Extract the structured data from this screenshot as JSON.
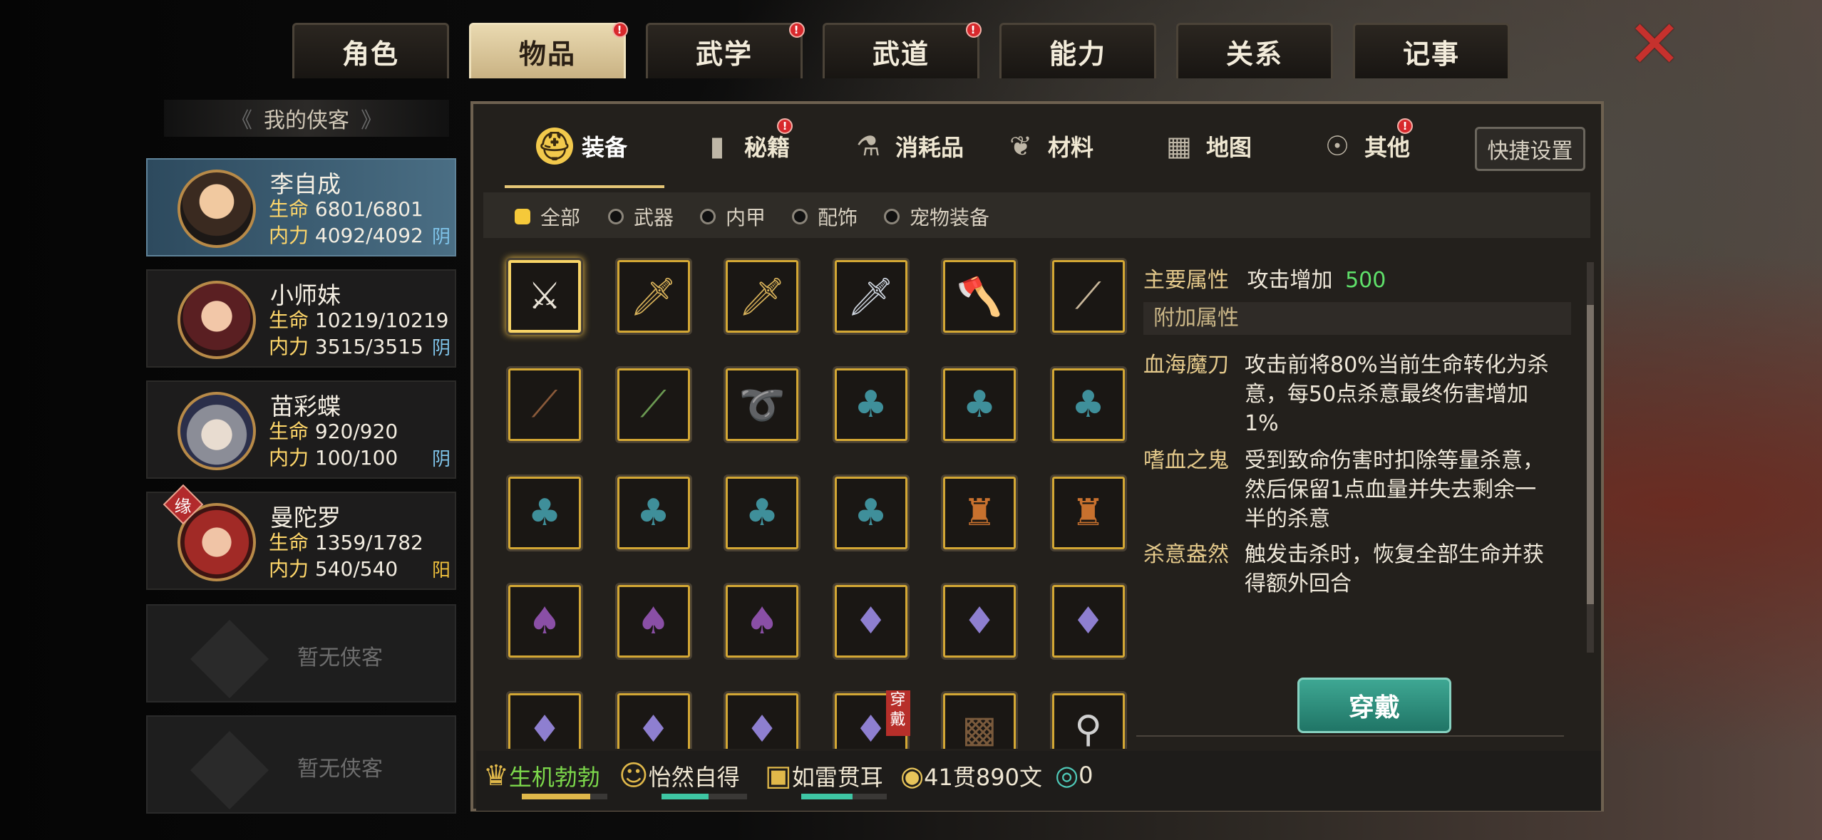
{
  "top_tabs": [
    {
      "label": "角色",
      "badge": false,
      "active": false
    },
    {
      "label": "物品",
      "badge": true,
      "active": true
    },
    {
      "label": "武学",
      "badge": true,
      "active": false
    },
    {
      "label": "武道",
      "badge": true,
      "active": false
    },
    {
      "label": "能力",
      "badge": false,
      "active": false
    },
    {
      "label": "关系",
      "badge": false,
      "active": false
    },
    {
      "label": "记事",
      "badge": false,
      "active": false
    }
  ],
  "badge_mark": "!",
  "left": {
    "header": "我的侠客",
    "heroes": [
      {
        "name": "李自成",
        "hp_label": "生命",
        "hp": "6801/6801",
        "mp_label": "内力",
        "mp": "4092/4092",
        "tag": "阴",
        "selected": true
      },
      {
        "name": "小师妹",
        "hp_label": "生命",
        "hp": "10219/10219",
        "mp_label": "内力",
        "mp": "3515/3515",
        "tag": "阴",
        "selected": false
      },
      {
        "name": "苗彩蝶",
        "hp_label": "生命",
        "hp": "920/920",
        "mp_label": "内力",
        "mp": "100/100",
        "tag": "阴",
        "selected": false
      },
      {
        "name": "曼陀罗",
        "hp_label": "生命",
        "hp": "1359/1782",
        "mp_label": "内力",
        "mp": "540/540",
        "tag": "阳",
        "selected": false,
        "fate": "缘"
      }
    ],
    "empty_slots": [
      "暂无侠客",
      "暂无侠客"
    ]
  },
  "sub_tabs": [
    {
      "label": "装备",
      "icon": "helmet-icon",
      "badge": false
    },
    {
      "label": "秘籍",
      "icon": "book-icon",
      "badge": true
    },
    {
      "label": "消耗品",
      "icon": "potion-icon",
      "badge": false
    },
    {
      "label": "材料",
      "icon": "herb-icon",
      "badge": false
    },
    {
      "label": "地图",
      "icon": "map-icon",
      "badge": false
    },
    {
      "label": "其他",
      "icon": "misc-icon",
      "badge": true
    }
  ],
  "quick_settings": "快捷设置",
  "filters": [
    {
      "label": "全部",
      "on": true
    },
    {
      "label": "武器",
      "on": false
    },
    {
      "label": "内甲",
      "on": false
    },
    {
      "label": "配饰",
      "on": false
    },
    {
      "label": "宠物装备",
      "on": false
    }
  ],
  "items": [
    {
      "icon": "saber-icon",
      "color": "#e8e2d6"
    },
    {
      "icon": "sword-icon",
      "color": "#d8b25a"
    },
    {
      "icon": "sword-icon",
      "color": "#d8b25a"
    },
    {
      "icon": "broadsword-icon",
      "color": "#cfd6e0"
    },
    {
      "icon": "axe-icon",
      "color": "#c77b3a"
    },
    {
      "icon": "spear-icon",
      "color": "#c9b79a"
    },
    {
      "icon": "staff-icon",
      "color": "#8a5a3a"
    },
    {
      "icon": "flute-icon",
      "color": "#6b9a52"
    },
    {
      "icon": "whip-icon",
      "color": "#5d8ea6"
    },
    {
      "icon": "cloak-icon",
      "color": "#3f8f9a"
    },
    {
      "icon": "cloak-icon",
      "color": "#3f8f9a"
    },
    {
      "icon": "cloak-icon",
      "color": "#3f8f9a"
    },
    {
      "icon": "cloak-icon",
      "color": "#3f8f9a"
    },
    {
      "icon": "cloak-icon",
      "color": "#3f8f9a"
    },
    {
      "icon": "cloak-icon",
      "color": "#3f8f9a"
    },
    {
      "icon": "cloak-icon",
      "color": "#3f8f9a"
    },
    {
      "icon": "armor-icon",
      "color": "#c8712e"
    },
    {
      "icon": "armor-icon",
      "color": "#c8712e"
    },
    {
      "icon": "robe-icon",
      "color": "#8a4fa6"
    },
    {
      "icon": "robe-icon",
      "color": "#8a4fa6"
    },
    {
      "icon": "robe-icon",
      "color": "#8a4fa6"
    },
    {
      "icon": "gown-icon",
      "color": "#8e7fd0"
    },
    {
      "icon": "gown-icon",
      "color": "#8e7fd0"
    },
    {
      "icon": "gown-icon",
      "color": "#8e7fd0"
    },
    {
      "icon": "gown-icon",
      "color": "#8e7fd0"
    },
    {
      "icon": "gown-icon",
      "color": "#8e7fd0"
    },
    {
      "icon": "gown-icon",
      "color": "#8e7fd0"
    },
    {
      "icon": "gown-icon",
      "color": "#8e7fd0",
      "worn": "穿戴"
    },
    {
      "icon": "vest-icon",
      "color": "#7a5a3c"
    },
    {
      "icon": "trinket-icon",
      "color": "#d0d0d0"
    }
  ],
  "detail": {
    "main_label": "主要属性",
    "main_text": "攻击增加",
    "main_value": "500",
    "extra_header": "附加属性",
    "effects": [
      {
        "name": "血海魔刀",
        "lines": [
          "攻击前将80%当前生命转化为杀",
          "意，每50点杀意最终伤害增加",
          "1%"
        ]
      },
      {
        "name": "嗜血之鬼",
        "lines": [
          "受到致命伤害时扣除等量杀意，",
          "然后保留1点血量并失去剩余一",
          "半的杀意"
        ]
      },
      {
        "name": "杀意盎然",
        "lines": [
          "触发击杀时，恢复全部生命并获",
          "得额外回合"
        ]
      }
    ],
    "wear_button": "穿戴"
  },
  "bottom": {
    "statuses": [
      {
        "label": "生机勃勃",
        "color": "#7cd84b",
        "fill": 0.8,
        "icon": "strength-icon"
      },
      {
        "label": "怡然自得",
        "color": "#efe6d2",
        "fill": 0.55,
        "icon": "smile-icon"
      },
      {
        "label": "如雷贯耳",
        "color": "#efe6d2",
        "fill": 0.6,
        "icon": "fame-icon"
      }
    ],
    "money": "41贯890文",
    "gems": "0"
  },
  "colors": {
    "accent": "#e6c777",
    "highlight_green": "#5fe06a",
    "teal": "#2f8f7d"
  }
}
